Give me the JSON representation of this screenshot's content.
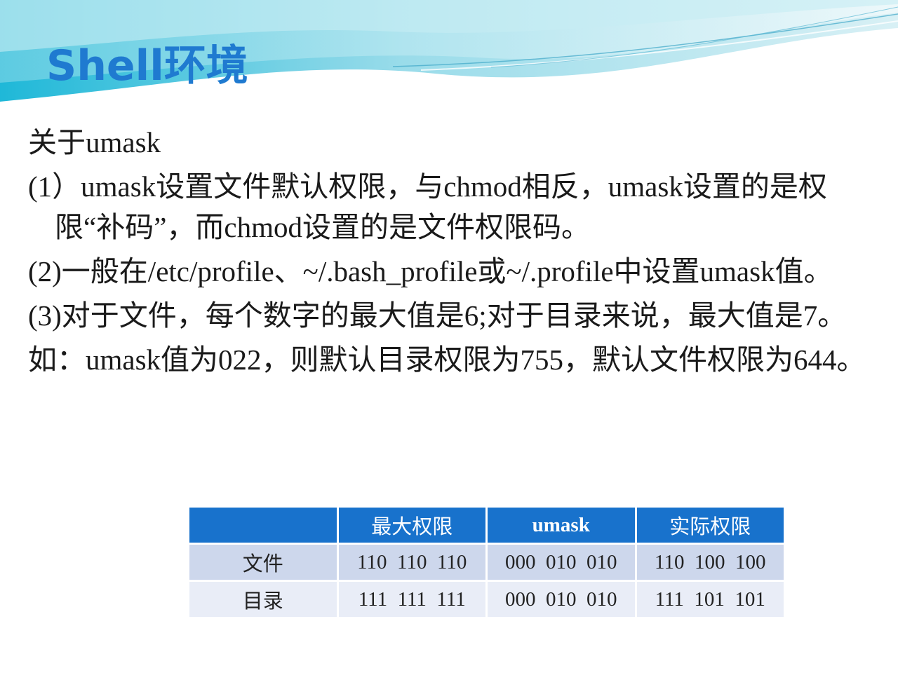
{
  "title": "Shell环境",
  "content": {
    "heading": "关于umask",
    "items": [
      "(1）umask设置文件默认权限，与chmod相反，umask设置的是权限“补码”，而chmod设置的是文件权限码。",
      "(2)一般在/etc/profile、~/.bash_profile或~/.profile中设置umask值。",
      "(3)对于文件，每个数字的最大值是6;对于目录来说，最大值是7。",
      "如：umask值为022，则默认目录权限为755，默认文件权限为644。"
    ]
  },
  "table": {
    "headers": [
      "",
      "最大权限",
      "umask",
      "实际权限"
    ],
    "rows": [
      [
        "文件",
        "110  110  110",
        "000  010  010",
        "110  100  100"
      ],
      [
        "目录",
        "111  111  111",
        "000  010  010",
        "111  101  101"
      ]
    ]
  },
  "colors": {
    "title": "#1f7ad0",
    "table_header": "#1872cc",
    "row_odd": "#cdd7ec",
    "row_even": "#e9edf7"
  }
}
